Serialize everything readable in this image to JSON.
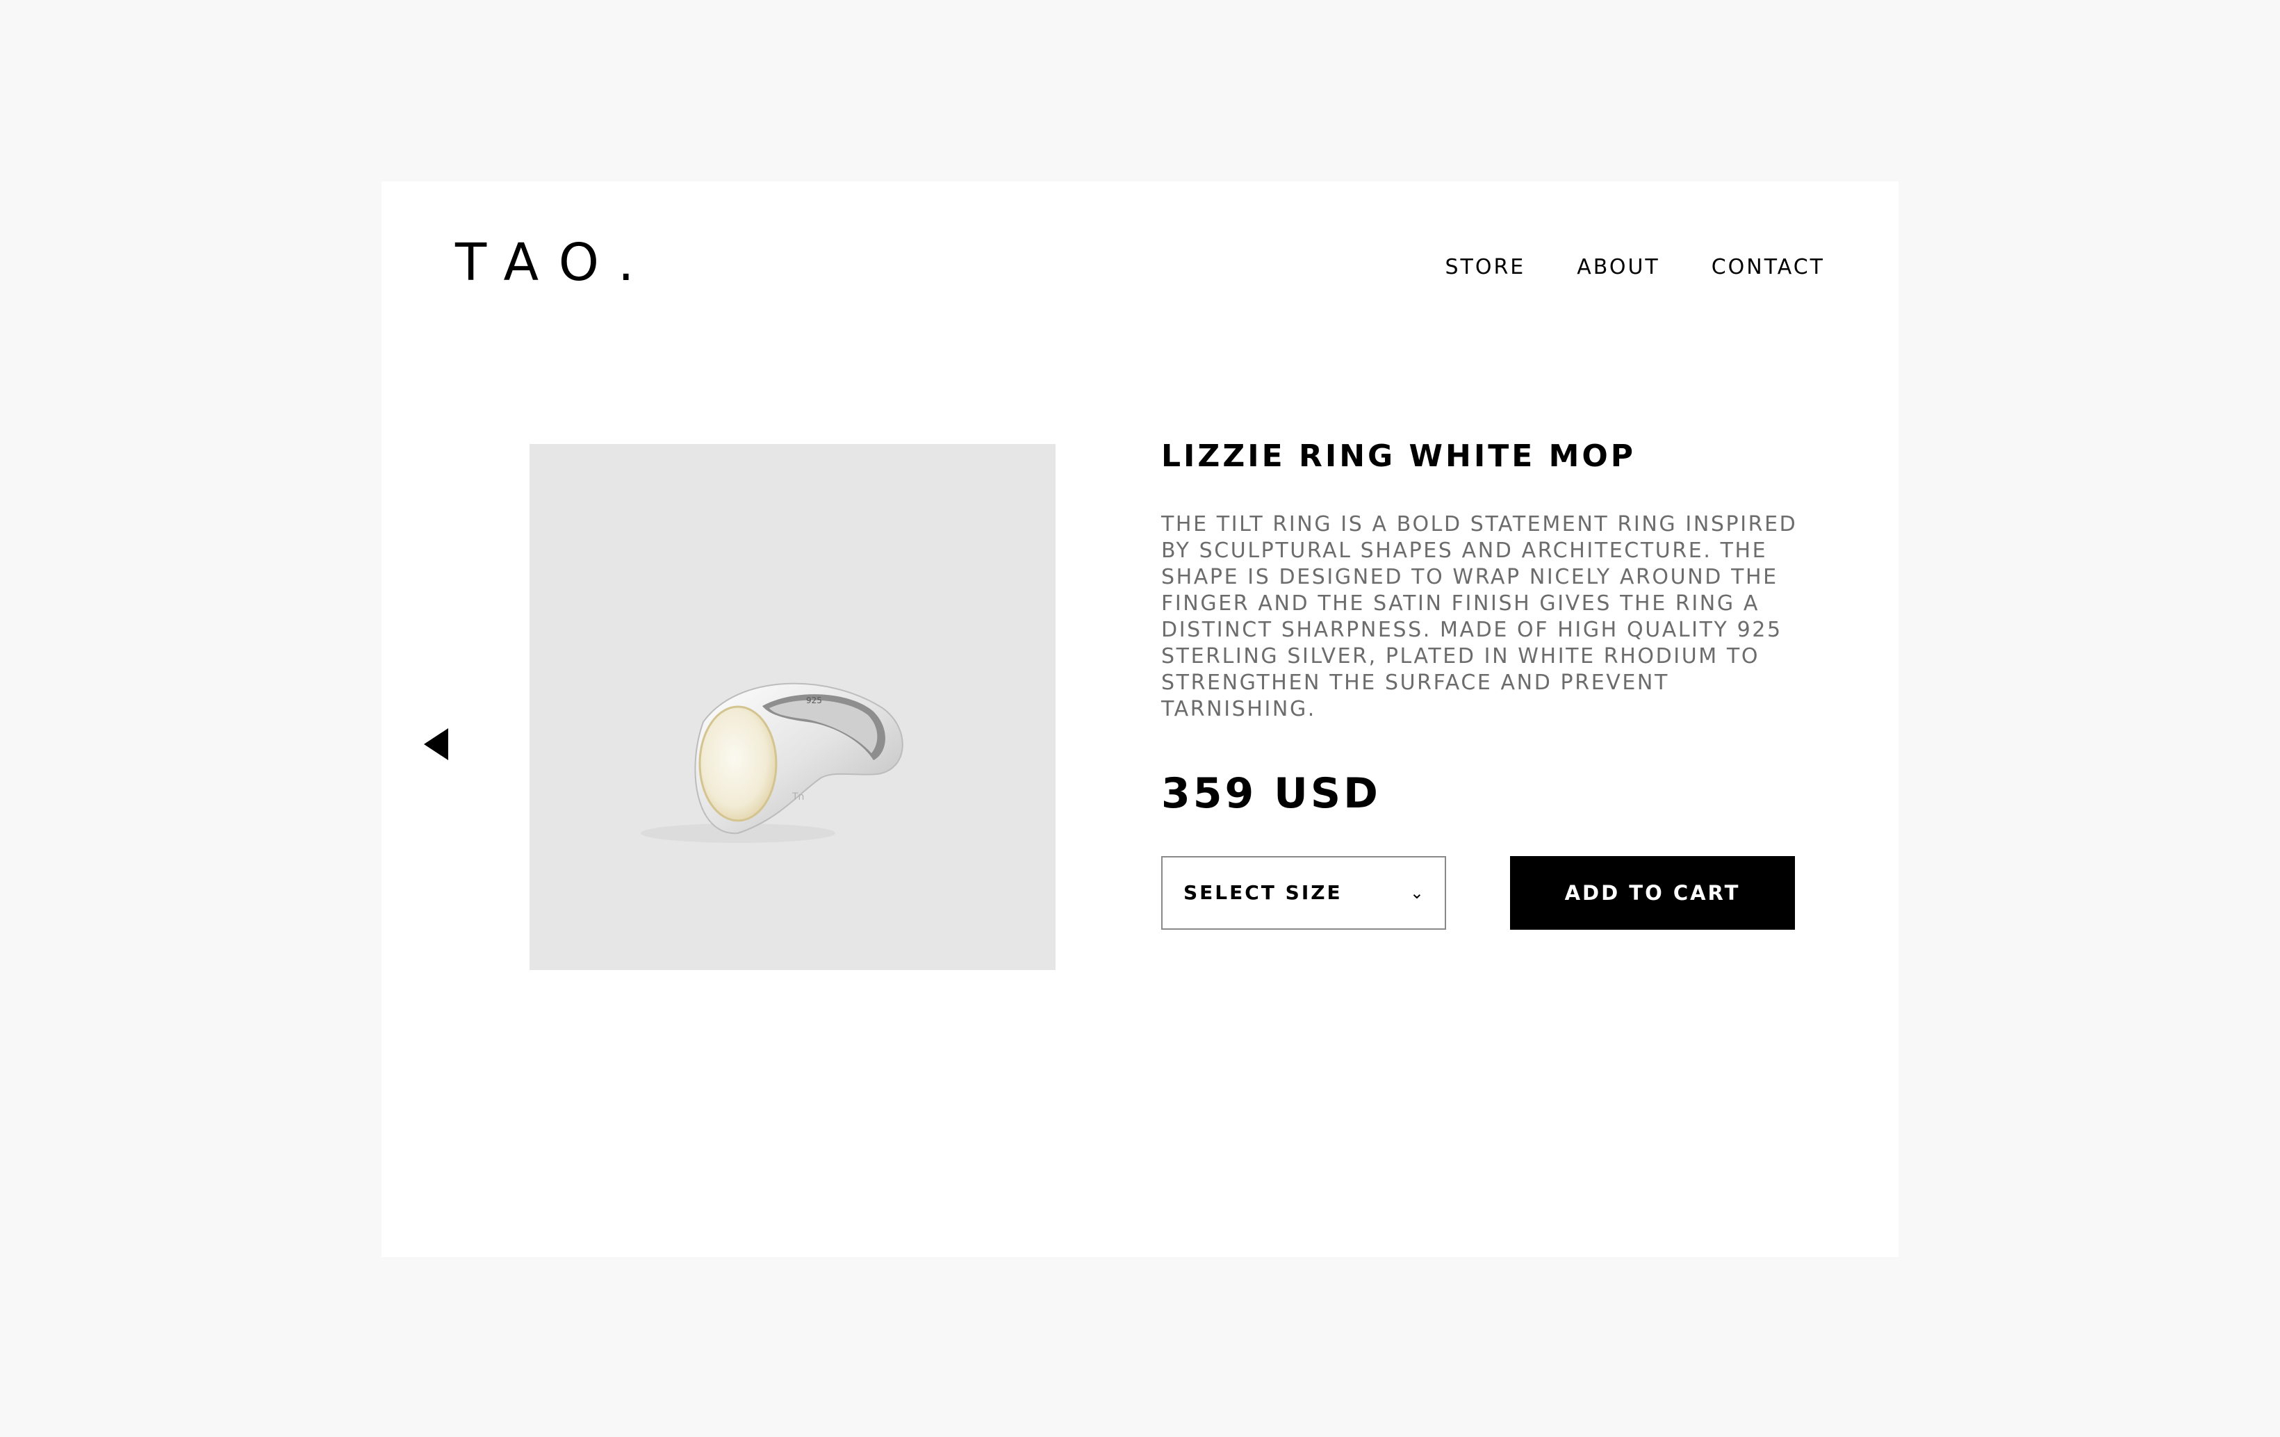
{
  "brand": {
    "logo": "TAO."
  },
  "nav": {
    "items": [
      {
        "label": "STORE"
      },
      {
        "label": "ABOUT"
      },
      {
        "label": "CONTACT"
      }
    ]
  },
  "gallery": {
    "prev_icon": "triangle-left-icon"
  },
  "product": {
    "name": "LIZZIE RING WHITE MOP",
    "description": "THE TILT RING IS A BOLD STATEMENT RING INSPIRED BY SCULPTURAL SHAPES AND ARCHITECTURE. THE SHAPE IS DESIGNED TO WRAP NICELY AROUND THE FINGER AND THE SATIN FINISH GIVES THE RING A DISTINCT SHARPNESS. MADE OF HIGH QUALITY 925 STERLING SILVER, PLATED IN WHITE RHODIUM TO STRENGTHEN THE SURFACE AND PREVENT TARNISHING.",
    "price": "359 USD",
    "ring_stamp": "925"
  },
  "actions": {
    "size_select_label": "SELECT SIZE",
    "size_select_icon": "chevron-down-icon",
    "add_to_cart_label": "ADD TO CART"
  },
  "colors": {
    "page_bg": "#f9f8f8",
    "card_bg": "#ffffff",
    "accent": "#000000",
    "image_bg": "#e6e6e6",
    "desc_text": "#6c6c6c"
  }
}
